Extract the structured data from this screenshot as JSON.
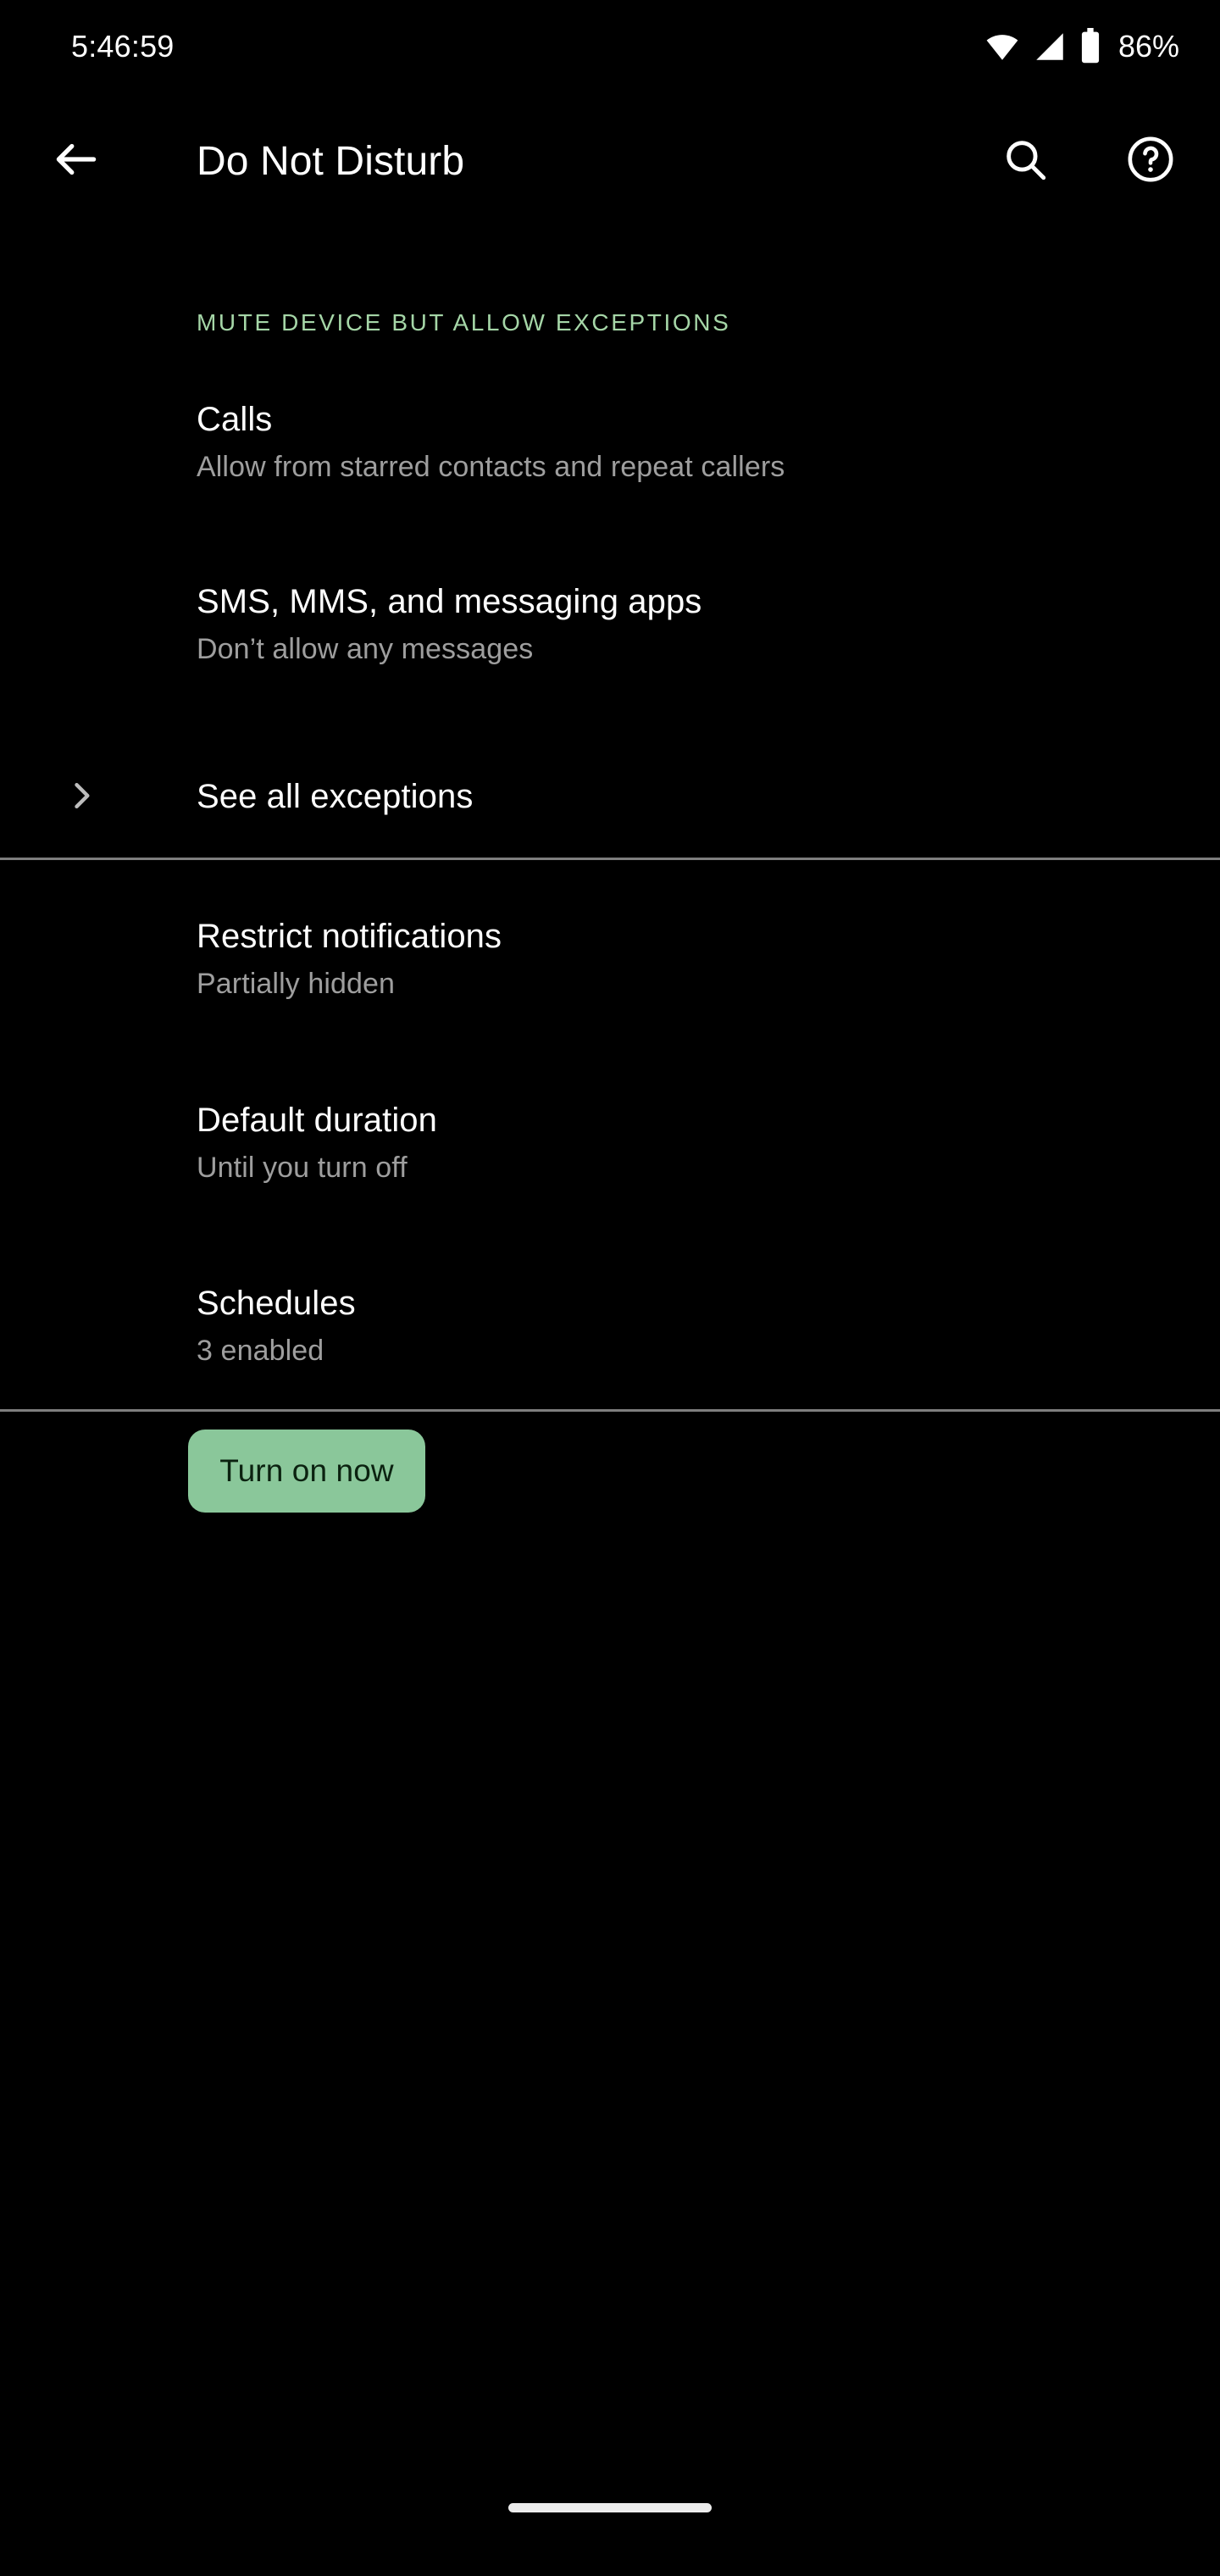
{
  "status_bar": {
    "clock": "5:46:59",
    "battery_percent": "86%",
    "icons": [
      "wifi-icon",
      "cellular-signal-icon",
      "battery-icon"
    ]
  },
  "app_bar": {
    "back_icon": "arrow-back-icon",
    "title": "Do Not Disturb",
    "search_icon": "search-icon",
    "help_icon": "help-circle-icon"
  },
  "sections": [
    {
      "header": "MUTE DEVICE BUT ALLOW EXCEPTIONS",
      "items": [
        {
          "title": "Calls",
          "summary": "Allow from starred contacts and repeat callers"
        },
        {
          "title": "SMS, MMS, and messaging apps",
          "summary": "Don’t allow any messages"
        },
        {
          "title": "See all exceptions",
          "summary": "",
          "icon": "chevron-right-icon"
        }
      ]
    },
    {
      "header": "",
      "items": [
        {
          "title": "Restrict notifications",
          "summary": "Partially hidden"
        },
        {
          "title": "Default duration",
          "summary": "Until you turn off"
        },
        {
          "title": "Schedules",
          "summary": "3 enabled"
        }
      ]
    }
  ],
  "footer": {
    "turn_on_label": "Turn on now"
  },
  "colors": {
    "background": "#000000",
    "accent_green": "#8ac79a",
    "section_header_green": "#a5d6a7",
    "primary_text": "#ffffff",
    "secondary_text": "#9e9e9e",
    "divider": "#7e7e7e"
  },
  "nav": {
    "gesture_pill": "home-gesture-pill"
  }
}
